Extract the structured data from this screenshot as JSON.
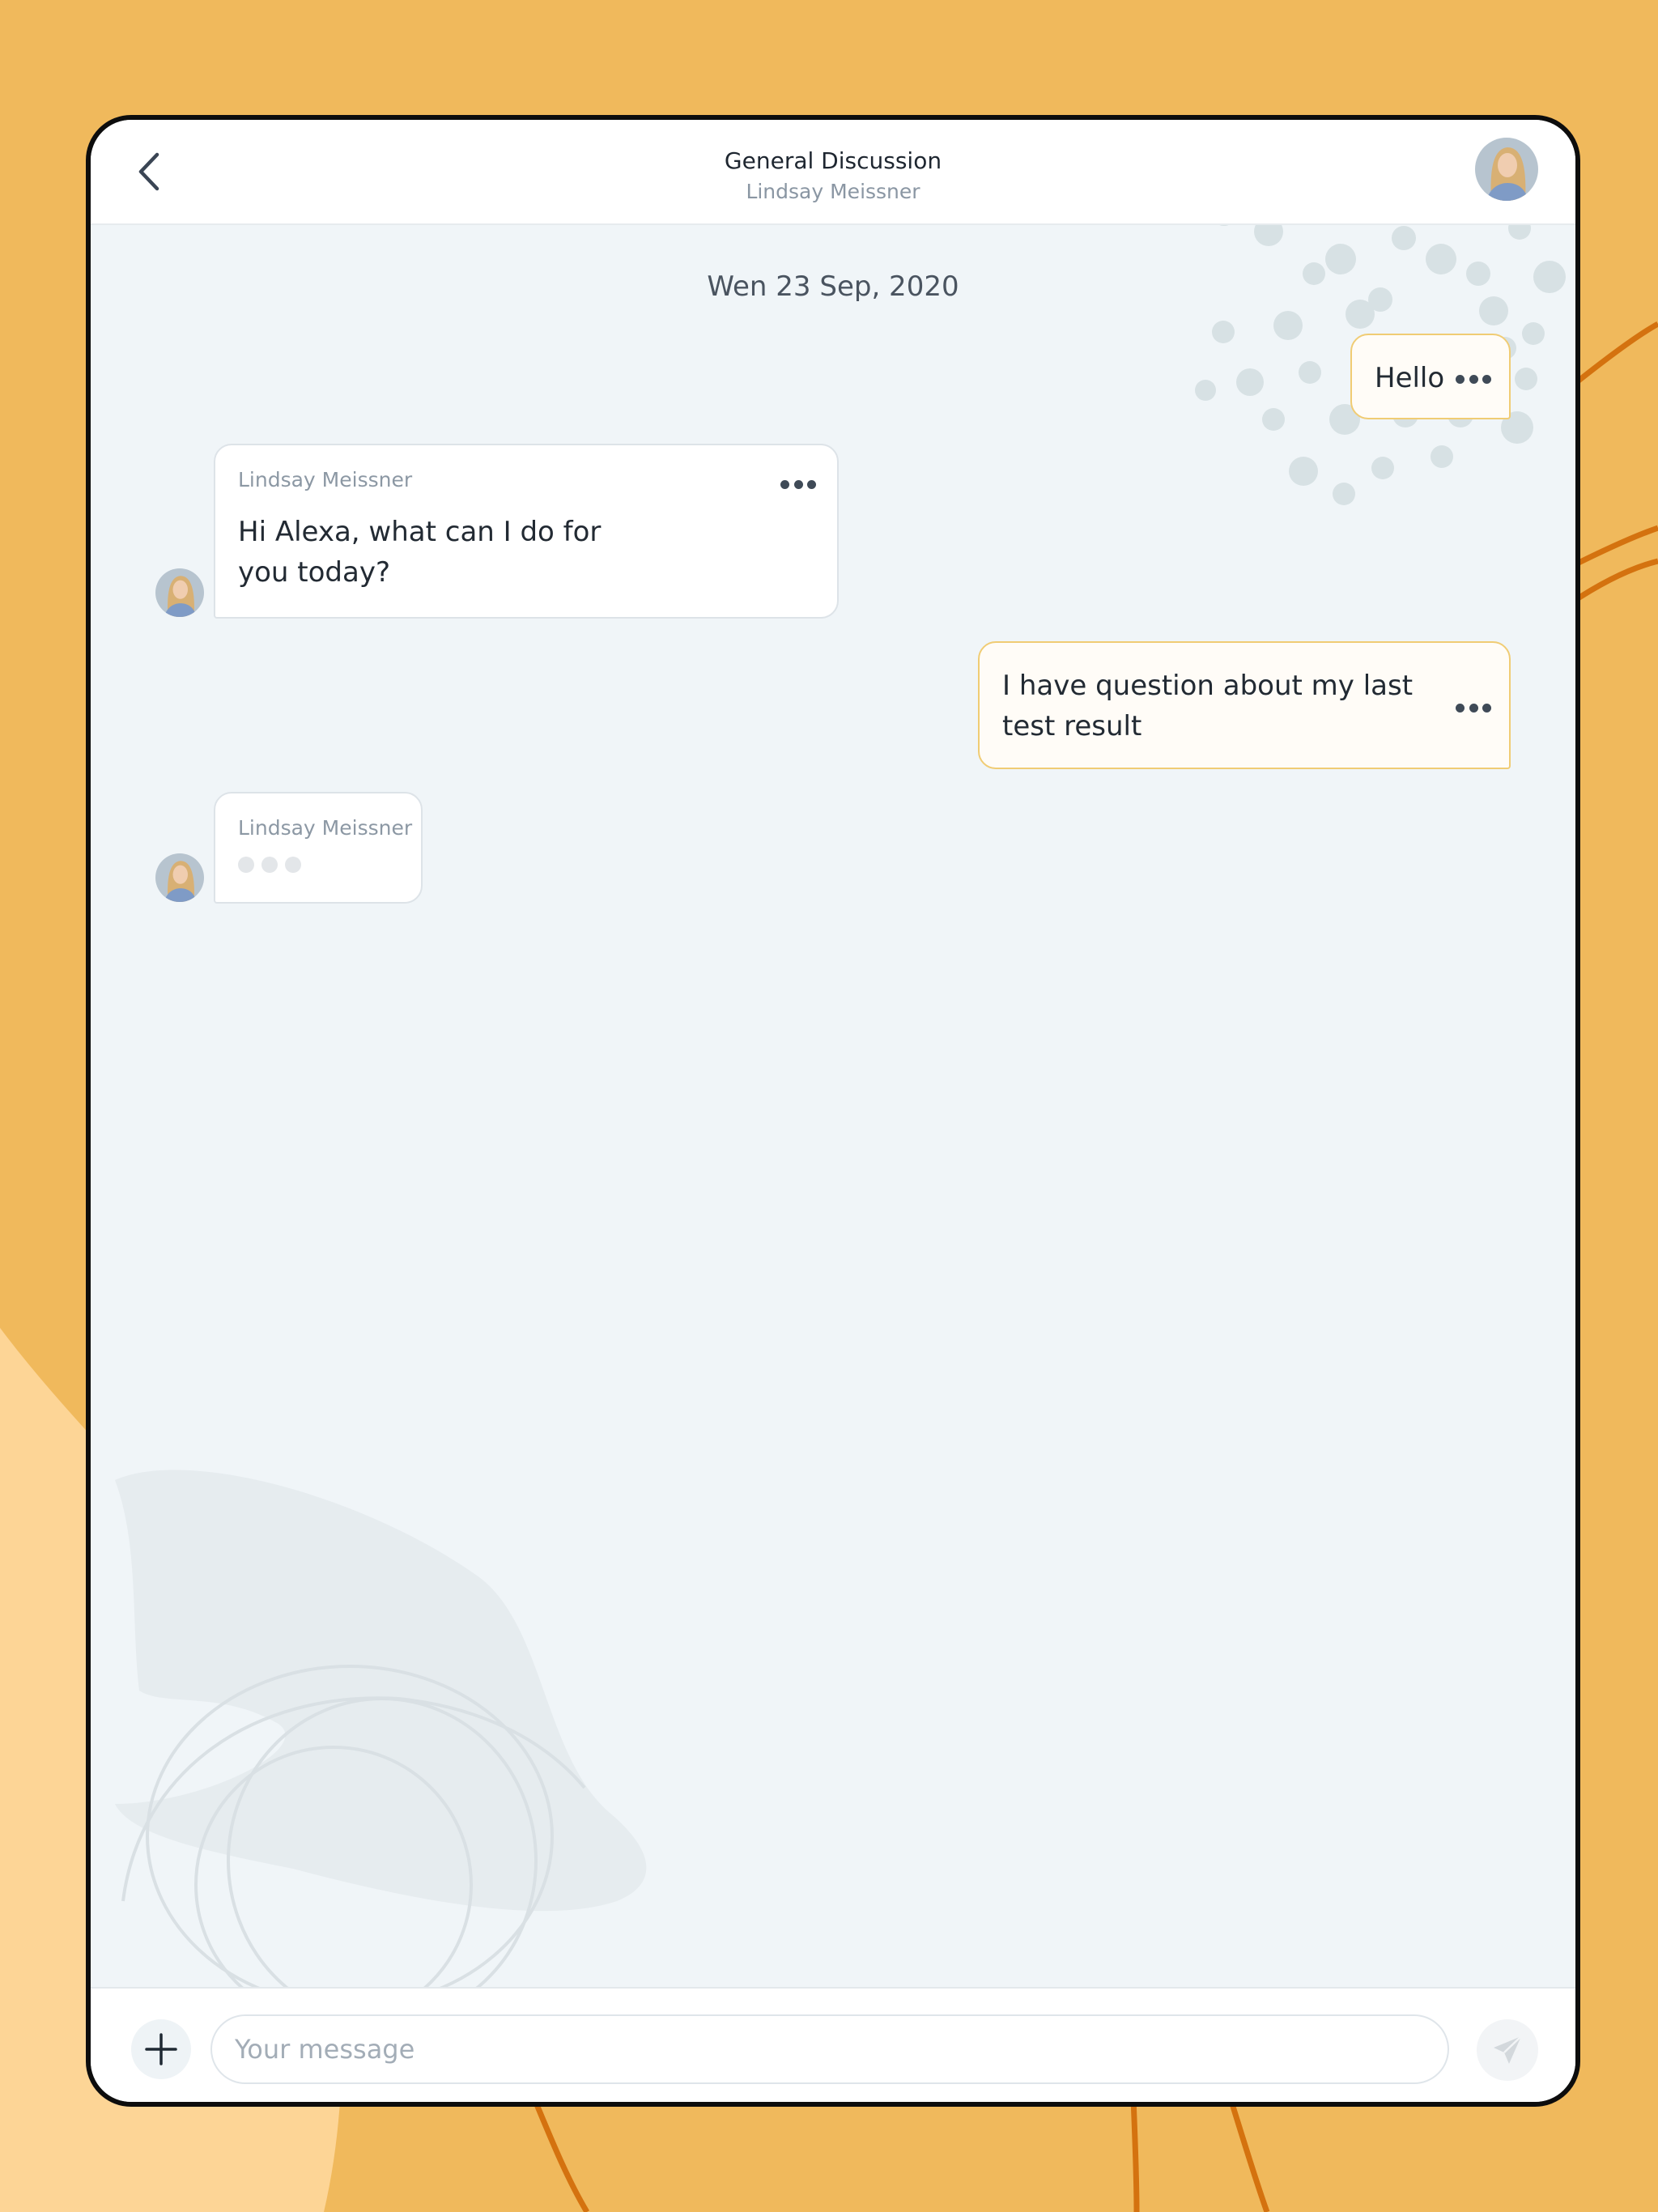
{
  "colors": {
    "background": "#f0b95c",
    "background_light": "#fdd596",
    "accent_line": "#d4720f",
    "chat_bg": "#f0f5f8",
    "outgoing_border": "#f0cc74"
  },
  "header": {
    "title": "General Discussion",
    "subtitle": "Lindsay Meissner",
    "back_icon": "chevron-left-icon",
    "avatar": "user-avatar"
  },
  "chat": {
    "date": "Wen 23 Sep, 2020",
    "messages": [
      {
        "direction": "outgoing",
        "text": "Hello"
      },
      {
        "direction": "incoming",
        "sender": "Lindsay Meissner",
        "text": "Hi Alexa, what can I do for you today?"
      },
      {
        "direction": "outgoing",
        "text": "I have question about my last test result"
      },
      {
        "direction": "incoming",
        "sender": "Lindsay Meissner",
        "typing": true
      }
    ]
  },
  "composer": {
    "placeholder": "Your message",
    "value": "",
    "add_icon": "plus-icon",
    "send_icon": "paper-plane-icon"
  }
}
